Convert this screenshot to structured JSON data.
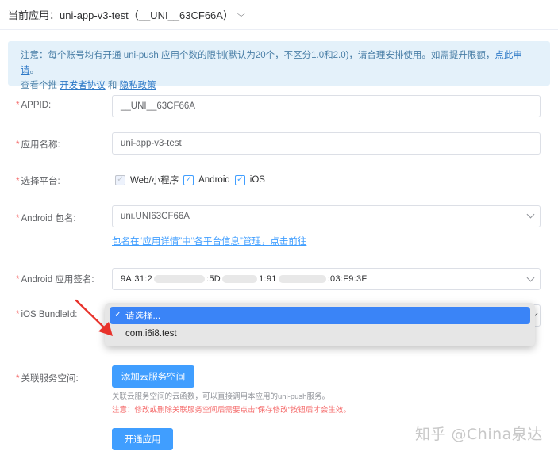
{
  "header": {
    "label": "当前应用：",
    "app_name": "uni-app-v3-test（__UNI__63CF66A）",
    "chevron_icon": "chevron-down-icon"
  },
  "notice": {
    "line1_text": "注意：每个账号均有开通 uni-push 应用个数的限制(默认为20个，不区分1.0和2.0)，请合理安排使用。如需提升限额，",
    "apply_link": "点此申请",
    "line1_end": "。",
    "line2_prefix": "查看个推 ",
    "dev_agreement_link": "开发者协议",
    "and": " 和 ",
    "privacy_link": "隐私政策"
  },
  "form": {
    "required_mark": "*",
    "appid_label": "APPID:",
    "appid_value": "__UNI__63CF66A",
    "appname_label": "应用名称:",
    "appname_value": "uni-app-v3-test",
    "platform_label": "选择平台:",
    "platforms": [
      {
        "name": "Web/小程序",
        "checked": true,
        "disabled": true
      },
      {
        "name": "Android",
        "checked": true,
        "disabled": false
      },
      {
        "name": "iOS",
        "checked": true,
        "disabled": false
      }
    ],
    "android_pkg_label": "Android 包名:",
    "android_pkg_value": "uni.UNI63CF66A",
    "android_pkg_hint": "包名在“应用详情”中“各平台信息”管理，点击前往",
    "android_sig_label": "Android 应用签名:",
    "android_sig_parts": [
      "9A:31:2",
      ":5D",
      "1:91",
      ":03:F9:3F"
    ],
    "ios_bundle_label": "iOS BundleId:",
    "ios_options": [
      "请选择...",
      "com.i6i8.test"
    ],
    "cloud_space_label": "关联服务空间:",
    "add_cloud_button": "添加云服务空间",
    "cloud_hint": "关联云服务空间的云函数，可以直接调用本应用的uni-push服务。",
    "cloud_warning": "注意：修改或删除关联服务空间后需要点击“保存修改”按钮后才会生效。",
    "submit_button": "开通应用"
  },
  "watermark": "知乎 @China泉达",
  "colors": {
    "primary": "#409eff",
    "required": "#f56c6c",
    "notice_bg": "#e4f1fa",
    "annotation_arrow": "#e8322b"
  }
}
